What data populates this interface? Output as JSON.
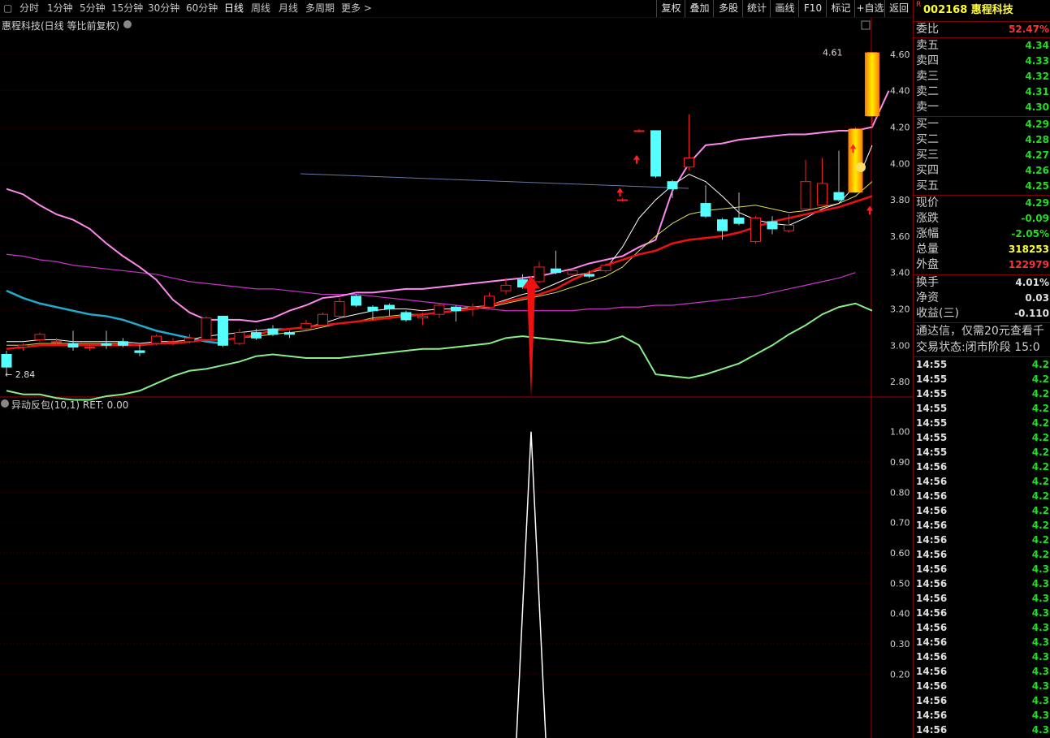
{
  "toolbar": {
    "periods": [
      "分时",
      "1分钟",
      "5分钟",
      "15分钟",
      "30分钟",
      "60分钟",
      "日线",
      "周线",
      "月线",
      "多周期",
      "更多 >"
    ],
    "active_period": "日线",
    "right_buttons": [
      "复权",
      "叠加",
      "多股",
      "统计",
      "画线",
      "F10",
      "标记",
      "+自选",
      "返回"
    ]
  },
  "chart": {
    "title": "惠程科技(日线 等比前复权)",
    "indicator_title": "异动反包(10,1)  RET: 0.00",
    "price_label_high": "4.61",
    "price_label_low": "2.84",
    "price_axis": [
      "4.60",
      "4.40",
      "4.20",
      "4.00",
      "3.80",
      "3.60",
      "3.40",
      "3.20",
      "3.00",
      "2.80"
    ],
    "indicator_axis": [
      "1.00",
      "0.90",
      "0.80",
      "0.70",
      "0.60",
      "0.50",
      "0.40",
      "0.30",
      "0.20"
    ]
  },
  "chart_data": {
    "type": "candlestick",
    "ylim": [
      2.72,
      4.72
    ],
    "candles": [
      [
        2.95,
        2.88,
        2.97,
        2.84
      ],
      [
        2.99,
        3.0,
        3.01,
        2.97
      ],
      [
        3.03,
        3.06,
        3.07,
        3.02
      ],
      [
        3.02,
        3.02,
        3.04,
        3.0
      ],
      [
        3.01,
        2.99,
        3.08,
        2.97
      ],
      [
        2.99,
        2.99,
        3.01,
        2.97
      ],
      [
        3.01,
        3.0,
        3.08,
        2.98
      ],
      [
        3.02,
        3.0,
        3.04,
        2.99
      ],
      [
        2.97,
        2.96,
        3.0,
        2.94
      ],
      [
        3.01,
        3.05,
        3.06,
        3.0
      ],
      [
        3.02,
        3.02,
        3.04,
        3.0
      ],
      [
        3.02,
        3.04,
        3.06,
        3.01
      ],
      [
        3.03,
        3.15,
        3.16,
        3.02
      ],
      [
        3.16,
        3.0,
        3.16,
        2.99
      ],
      [
        3.01,
        3.07,
        3.09,
        3.0
      ],
      [
        3.07,
        3.04,
        3.09,
        3.03
      ],
      [
        3.09,
        3.06,
        3.11,
        3.05
      ],
      [
        3.07,
        3.06,
        3.08,
        3.04
      ],
      [
        3.09,
        3.12,
        3.14,
        3.08
      ],
      [
        3.11,
        3.17,
        3.18,
        3.1
      ],
      [
        3.16,
        3.24,
        3.26,
        3.15
      ],
      [
        3.27,
        3.22,
        3.28,
        3.21
      ],
      [
        3.21,
        3.19,
        3.22,
        3.14
      ],
      [
        3.22,
        3.2,
        3.23,
        3.16
      ],
      [
        3.18,
        3.14,
        3.19,
        3.13
      ],
      [
        3.15,
        3.16,
        3.18,
        3.11
      ],
      [
        3.17,
        3.22,
        3.23,
        3.15
      ],
      [
        3.21,
        3.19,
        3.22,
        3.13
      ],
      [
        3.2,
        3.21,
        3.23,
        3.16
      ],
      [
        3.21,
        3.27,
        3.29,
        3.2
      ],
      [
        3.3,
        3.33,
        3.37,
        3.28
      ],
      [
        3.36,
        3.32,
        3.39,
        3.31
      ],
      [
        3.35,
        3.43,
        3.46,
        3.34
      ],
      [
        3.42,
        3.4,
        3.52,
        3.39
      ],
      [
        3.39,
        3.41,
        3.42,
        3.38
      ],
      [
        3.39,
        3.38,
        3.41,
        3.37
      ],
      [
        3.41,
        3.44,
        3.45,
        3.4
      ],
      [
        3.8,
        3.8,
        3.81,
        3.79
      ],
      [
        4.18,
        4.18,
        4.19,
        4.17
      ],
      [
        4.18,
        3.93,
        4.18,
        3.92
      ],
      [
        3.9,
        3.86,
        3.91,
        3.81
      ],
      [
        3.98,
        4.03,
        4.27,
        3.96
      ],
      [
        3.78,
        3.71,
        3.88,
        3.7
      ],
      [
        3.69,
        3.63,
        3.7,
        3.58
      ],
      [
        3.7,
        3.67,
        3.84,
        3.66
      ],
      [
        3.57,
        3.7,
        3.71,
        3.56
      ],
      [
        3.68,
        3.64,
        3.71,
        3.61
      ],
      [
        3.63,
        3.66,
        3.72,
        3.62
      ],
      [
        3.75,
        3.9,
        4.02,
        3.74
      ],
      [
        3.77,
        3.89,
        4.03,
        3.77
      ],
      [
        3.84,
        3.8,
        4.07,
        3.79
      ],
      [
        3.85,
        4.19,
        4.2,
        3.84
      ],
      [
        4.26,
        4.61,
        4.61,
        4.2
      ]
    ],
    "upper_pink": [
      3.86,
      3.83,
      3.77,
      3.72,
      3.69,
      3.64,
      3.56,
      3.49,
      3.43,
      3.36,
      3.25,
      3.18,
      3.14,
      3.14,
      3.14,
      3.13,
      3.15,
      3.19,
      3.22,
      3.26,
      3.27,
      3.29,
      3.29,
      3.3,
      3.31,
      3.31,
      3.32,
      3.33,
      3.34,
      3.35,
      3.36,
      3.37,
      3.38,
      3.4,
      3.42,
      3.45,
      3.47,
      3.49,
      3.54,
      3.58,
      3.85,
      4.0,
      4.1,
      4.11,
      4.13,
      4.14,
      4.15,
      4.16,
      4.16,
      4.17,
      4.18,
      4.18,
      4.2,
      4.4
    ],
    "lower_green": [
      2.75,
      2.73,
      2.73,
      2.71,
      2.7,
      2.7,
      2.72,
      2.73,
      2.75,
      2.79,
      2.83,
      2.86,
      2.87,
      2.89,
      2.91,
      2.94,
      2.95,
      2.94,
      2.93,
      2.93,
      2.93,
      2.94,
      2.95,
      2.96,
      2.97,
      2.98,
      2.98,
      2.99,
      3.0,
      3.01,
      3.04,
      3.05,
      3.04,
      3.03,
      3.02,
      3.01,
      3.02,
      3.05,
      3.0,
      2.84,
      2.83,
      2.82,
      2.84,
      2.87,
      2.9,
      2.95,
      3.0,
      3.06,
      3.11,
      3.17,
      3.21,
      3.23,
      3.19
    ],
    "ma_red": [
      2.98,
      2.99,
      3.0,
      3.0,
      3.0,
      3.0,
      3.0,
      3.0,
      3.0,
      3.01,
      3.01,
      3.02,
      3.03,
      3.03,
      3.04,
      3.06,
      3.08,
      3.09,
      3.1,
      3.11,
      3.12,
      3.13,
      3.14,
      3.15,
      3.16,
      3.17,
      3.18,
      3.19,
      3.2,
      3.22,
      3.24,
      3.26,
      3.28,
      3.31,
      3.36,
      3.4,
      3.44,
      3.47,
      3.5,
      3.52,
      3.56,
      3.58,
      3.59,
      3.6,
      3.62,
      3.65,
      3.68,
      3.7,
      3.72,
      3.74,
      3.76,
      3.79,
      3.82
    ],
    "ma_cyan": [
      3.3,
      3.26,
      3.23,
      3.21,
      3.19,
      3.17,
      3.16,
      3.14,
      3.11,
      3.08,
      3.06,
      3.04,
      3.02,
      3.01
    ],
    "ma_magenta": [
      3.5,
      3.49,
      3.47,
      3.46,
      3.44,
      3.43,
      3.42,
      3.41,
      3.4,
      3.39,
      3.37,
      3.35,
      3.34,
      3.33,
      3.32,
      3.31,
      3.31,
      3.3,
      3.29,
      3.28,
      3.28,
      3.28,
      3.27,
      3.26,
      3.25,
      3.24,
      3.23,
      3.22,
      3.21,
      3.2,
      3.19,
      3.19,
      3.19,
      3.19,
      3.19,
      3.2,
      3.2,
      3.21,
      3.21,
      3.22,
      3.22,
      3.23,
      3.24,
      3.25,
      3.26,
      3.27,
      3.29,
      3.31,
      3.33,
      3.35,
      3.37,
      3.4
    ],
    "ma_white": [
      3.02,
      3.02,
      3.03,
      3.03,
      3.02,
      3.02,
      3.02,
      3.02,
      3.01,
      3.02,
      3.02,
      3.03,
      3.05,
      3.06,
      3.07,
      3.08,
      3.09,
      3.09,
      3.1,
      3.12,
      3.15,
      3.17,
      3.19,
      3.2,
      3.2,
      3.19,
      3.2,
      3.2,
      3.21,
      3.22,
      3.25,
      3.28,
      3.3,
      3.34,
      3.38,
      3.4,
      3.42,
      3.54,
      3.7,
      3.8,
      3.88,
      3.94,
      3.9,
      3.82,
      3.73,
      3.69,
      3.67,
      3.66,
      3.7,
      3.75,
      3.78,
      3.88,
      4.1
    ],
    "ma_yellow": [
      3.0,
      3.0,
      3.01,
      3.01,
      3.01,
      3.01,
      3.01,
      3.01,
      3.0,
      3.01,
      3.01,
      3.02,
      3.03,
      3.03,
      3.04,
      3.05,
      3.06,
      3.07,
      3.08,
      3.1,
      3.12,
      3.13,
      3.15,
      3.16,
      3.17,
      3.17,
      3.18,
      3.19,
      3.2,
      3.21,
      3.23,
      3.25,
      3.27,
      3.29,
      3.32,
      3.35,
      3.38,
      3.43,
      3.52,
      3.6,
      3.67,
      3.72,
      3.74,
      3.75,
      3.76,
      3.77,
      3.75,
      3.73,
      3.74,
      3.76,
      3.78,
      3.82,
      3.9
    ],
    "indicator": {
      "values_peak_index": 31,
      "peak_value": 1.0,
      "ylim": [
        0,
        1.05
      ]
    }
  },
  "quote": {
    "code": "002168",
    "name": "惠程科技",
    "badge": "R",
    "weibi_label": "委比",
    "weibi_value": "52.47%",
    "sell": [
      {
        "label": "卖五",
        "price": "4.34"
      },
      {
        "label": "卖四",
        "price": "4.33"
      },
      {
        "label": "卖三",
        "price": "4.32"
      },
      {
        "label": "卖二",
        "price": "4.31"
      },
      {
        "label": "卖一",
        "price": "4.30"
      }
    ],
    "buy": [
      {
        "label": "买一",
        "price": "4.29"
      },
      {
        "label": "买二",
        "price": "4.28"
      },
      {
        "label": "买三",
        "price": "4.27"
      },
      {
        "label": "买四",
        "price": "4.26"
      },
      {
        "label": "买五",
        "price": "4.25"
      }
    ],
    "stats": [
      {
        "label": "现价",
        "value": "4.29",
        "color": "#22dd22"
      },
      {
        "label": "涨跌",
        "value": "-0.09",
        "color": "#22dd22"
      },
      {
        "label": "涨幅",
        "value": "-2.05%",
        "color": "#22dd22"
      },
      {
        "label": "总量",
        "value": "318253",
        "color": "#ffff33"
      },
      {
        "label": "外盘",
        "value": "122979",
        "color": "#ff3333"
      }
    ],
    "stats2": [
      {
        "label": "换手",
        "value": "4.01%",
        "color": "#e0e0e0"
      },
      {
        "label": "净资",
        "value": "0.03",
        "color": "#e0e0e0"
      },
      {
        "label": "收益(三)",
        "value": "-0.110",
        "color": "#e0e0e0"
      }
    ],
    "notice": "通达信，仅需20元查看千",
    "status_label": "交易状态:",
    "status_value": "闭市阶段 15:0",
    "ticks": [
      {
        "t": "14:55",
        "p": "4.2"
      },
      {
        "t": "14:55",
        "p": "4.2"
      },
      {
        "t": "14:55",
        "p": "4.2"
      },
      {
        "t": "14:55",
        "p": "4.2"
      },
      {
        "t": "14:55",
        "p": "4.2"
      },
      {
        "t": "14:55",
        "p": "4.2"
      },
      {
        "t": "14:55",
        "p": "4.2"
      },
      {
        "t": "14:56",
        "p": "4.2"
      },
      {
        "t": "14:56",
        "p": "4.2"
      },
      {
        "t": "14:56",
        "p": "4.2"
      },
      {
        "t": "14:56",
        "p": "4.2"
      },
      {
        "t": "14:56",
        "p": "4.2"
      },
      {
        "t": "14:56",
        "p": "4.2"
      },
      {
        "t": "14:56",
        "p": "4.2"
      },
      {
        "t": "14:56",
        "p": "4.3"
      },
      {
        "t": "14:56",
        "p": "4.3"
      },
      {
        "t": "14:56",
        "p": "4.3"
      },
      {
        "t": "14:56",
        "p": "4.3"
      },
      {
        "t": "14:56",
        "p": "4.3"
      },
      {
        "t": "14:56",
        "p": "4.3"
      },
      {
        "t": "14:56",
        "p": "4.3"
      },
      {
        "t": "14:56",
        "p": "4.3"
      },
      {
        "t": "14:56",
        "p": "4.3"
      },
      {
        "t": "14:56",
        "p": "4.3"
      },
      {
        "t": "14:56",
        "p": "4.3"
      },
      {
        "t": "14:56",
        "p": "4.3"
      }
    ]
  }
}
